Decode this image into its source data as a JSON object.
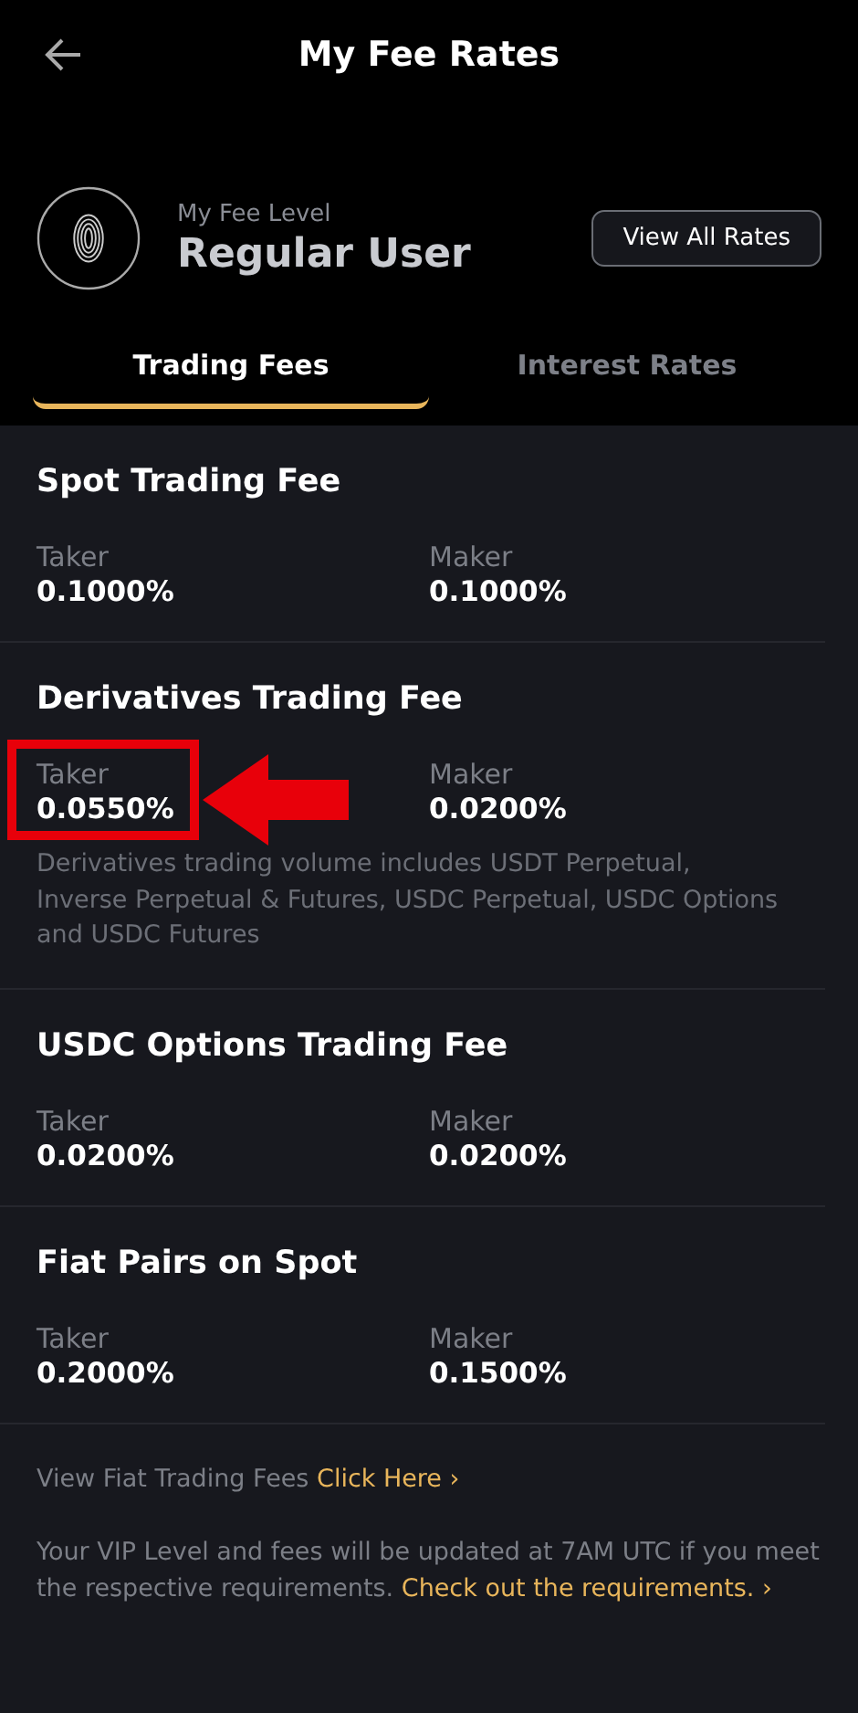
{
  "header": {
    "title": "My Fee Rates",
    "level_label": "My Fee Level",
    "level": "Regular User",
    "view_all": "View All Rates"
  },
  "tabs": [
    {
      "label": "Trading Fees",
      "selected": true
    },
    {
      "label": "Interest Rates",
      "selected": false
    }
  ],
  "sections": [
    {
      "title": "Spot Trading Fee",
      "rates": [
        {
          "label": "Taker",
          "value": "0.1000%",
          "highlighted": false
        },
        {
          "label": "Maker",
          "value": "0.1000%",
          "highlighted": false
        }
      ]
    },
    {
      "title": "Derivatives Trading Fee",
      "rates": [
        {
          "label": "Taker",
          "value": "0.0550%",
          "highlighted": true
        },
        {
          "label": "Maker",
          "value": "0.0200%",
          "highlighted": false
        }
      ],
      "note": "Derivatives trading volume includes USDT Perpetual, Inverse Perpetual & Futures, USDC Perpetual, USDC Options and USDC Futures"
    },
    {
      "title": "USDC Options Trading Fee",
      "rates": [
        {
          "label": "Taker",
          "value": "0.0200%",
          "highlighted": false
        },
        {
          "label": "Maker",
          "value": "0.0200%",
          "highlighted": false
        }
      ]
    },
    {
      "title": "Fiat Pairs on Spot",
      "rates": [
        {
          "label": "Taker",
          "value": "0.2000%",
          "highlighted": false
        },
        {
          "label": "Maker",
          "value": "0.1500%",
          "highlighted": false
        }
      ]
    }
  ],
  "footer": {
    "fiat_text": "View Fiat Trading Fees",
    "fiat_link": "Click Here ›",
    "vip_text": "Your VIP Level and fees will be updated at 7AM UTC if you meet the respective requirements.",
    "vip_link": "Check out the requirements. ›"
  }
}
